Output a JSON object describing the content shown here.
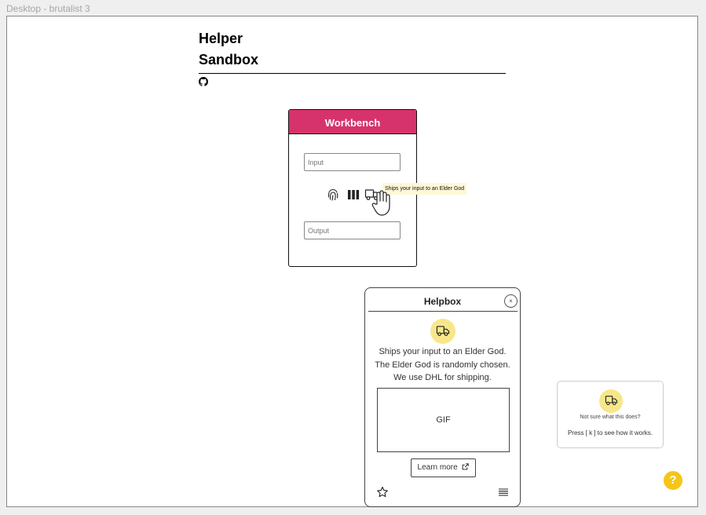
{
  "frame": {
    "label": "Desktop - brutalist 3"
  },
  "header": {
    "title_line1": "Helper",
    "title_line2": "Sandbox",
    "github_icon": "github-icon"
  },
  "workbench": {
    "title": "Workbench",
    "input_placeholder": "Input",
    "output_placeholder": "Output",
    "tools": [
      "fingerprint-icon",
      "columns-icon",
      "truck-icon"
    ],
    "accent_color": "#d6336c"
  },
  "tooltip": {
    "text": "Ships your input to an Elder God"
  },
  "helpbox": {
    "title": "Helpbox",
    "close_symbol": "×",
    "description_lines": [
      "Ships your input to an Elder God.",
      "The Elder God is randomly chosen.",
      "We use DHL for shipping."
    ],
    "gif_label": "GIF",
    "learn_more_label": "Learn more",
    "badge_color": "#f7e78a"
  },
  "hint": {
    "question": "Not sure what this does?",
    "instruction": "Press [ k ] to see how it works."
  },
  "help_fab": {
    "label": "?",
    "color": "#f5c518"
  }
}
